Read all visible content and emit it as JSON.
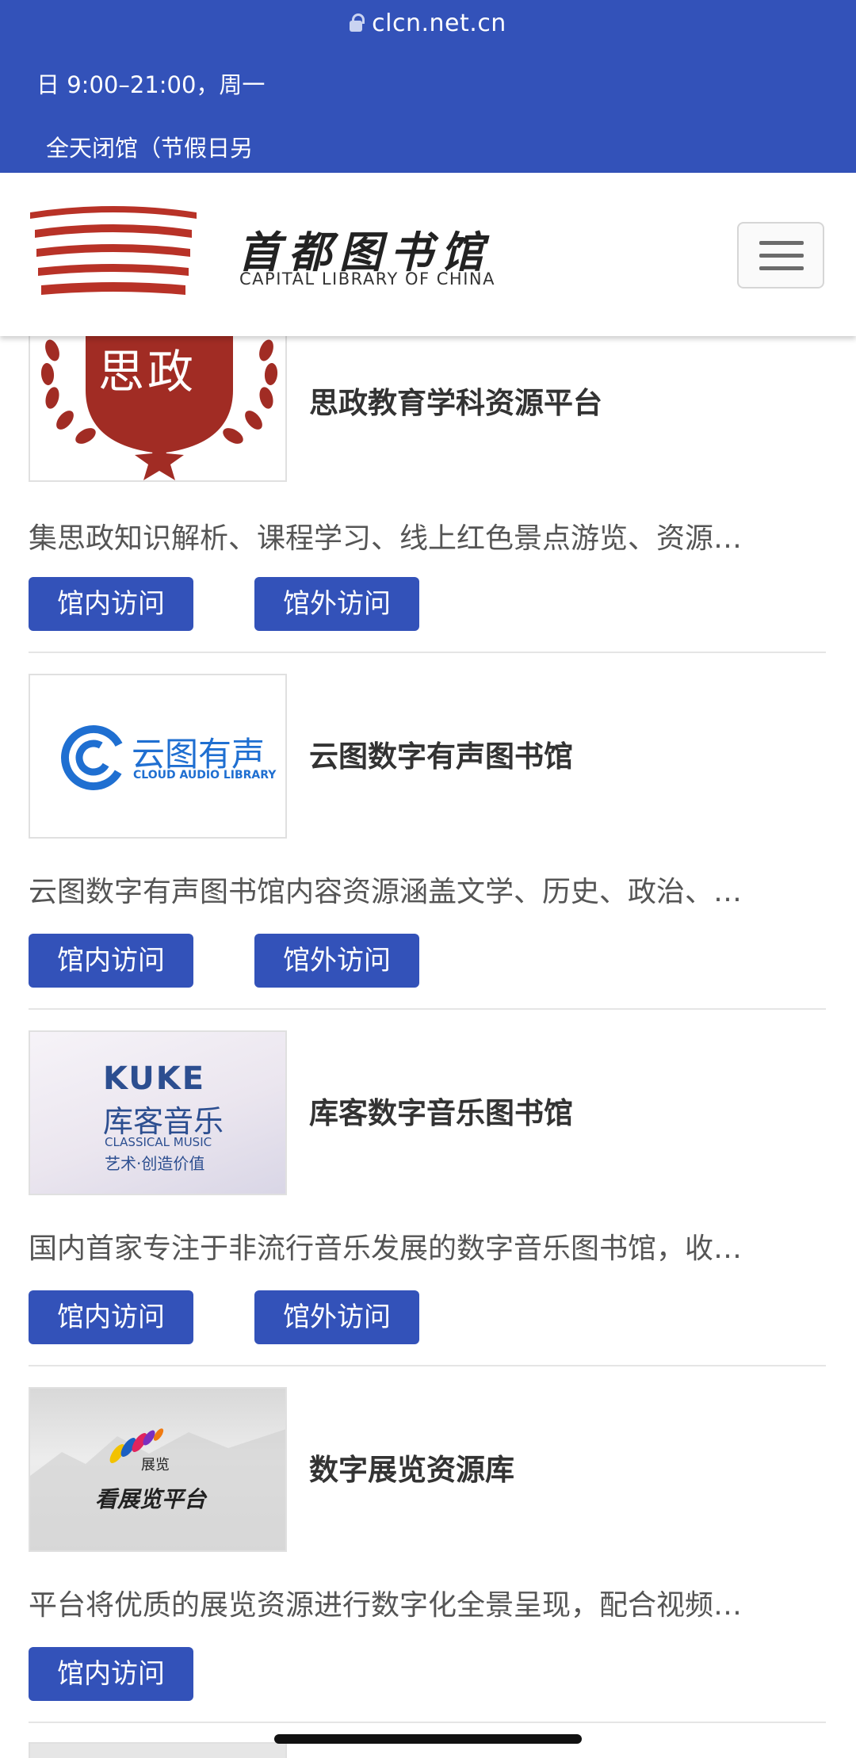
{
  "browser": {
    "url": "clcn.net.cn",
    "hours": "日 9:00–21:00，周一",
    "closed": "全天闭馆（节假日另"
  },
  "header": {
    "logo_cn": "首都图书馆",
    "logo_en": "CAPITAL LIBRARY OF CHINA",
    "menu_icon": "hamburger-icon",
    "brand_color": "#3352b9"
  },
  "resources": [
    {
      "title": "思政教育学科资源平台",
      "logo_text": "思政",
      "description": "集思政知识解析、课程学习、线上红色景点游览、资源…",
      "inside_label": "馆内访问",
      "outside_label": "馆外访问"
    },
    {
      "title": "云图数字有声图书馆",
      "logo_text": "云图有声",
      "logo_subtext": "CLOUD AUDIO LIBRARY",
      "description": "云图数字有声图书馆内容资源涵盖文学、历史、政治、…",
      "inside_label": "馆内访问",
      "outside_label": "馆外访问"
    },
    {
      "title": "库客数字音乐图书馆",
      "logo_text": "KUKE",
      "logo_cn": "库客音乐",
      "logo_sub1": "CLASSICAL MUSIC",
      "logo_sub2": "艺术·创造价值",
      "description": "国内首家专注于非流行音乐发展的数字音乐图书馆，收…",
      "inside_label": "馆内访问",
      "outside_label": "馆外访问"
    },
    {
      "title": "数字展览资源库",
      "logo_text": "展览",
      "logo_sub": "看展览平台",
      "description": "平台将优质的展览资源进行数字化全景呈现，配合视频…",
      "inside_label": "馆内访问"
    }
  ]
}
